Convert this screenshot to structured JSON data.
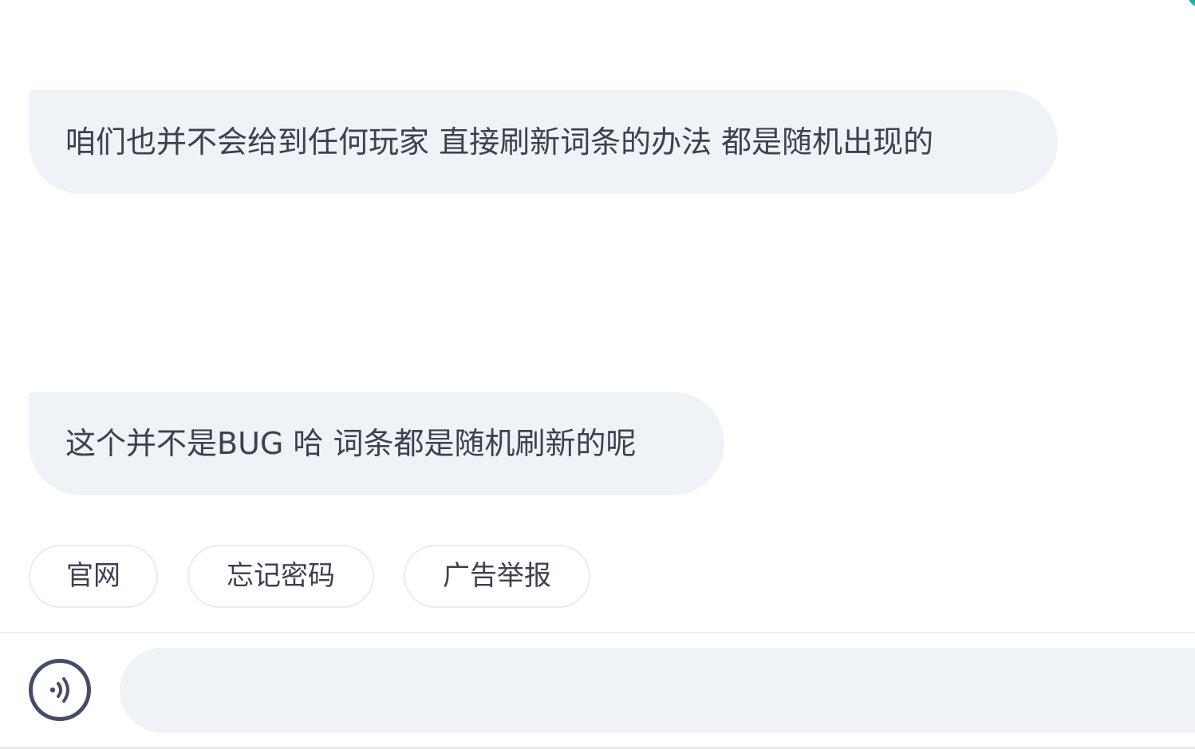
{
  "messages": [
    {
      "text": "咱们也并不会给到任何玩家 直接刷新词条的办法 都是随机出现的"
    },
    {
      "text": "这个并不是BUG 哈 词条都是随机刷新的呢"
    }
  ],
  "quick_replies": [
    {
      "label": "官网"
    },
    {
      "label": "忘记密码"
    },
    {
      "label": "广告举报"
    }
  ],
  "input": {
    "value": "",
    "placeholder": ""
  },
  "icons": {
    "voice": "voice-input-icon"
  },
  "colors": {
    "bubble_bg": "#eff3f7",
    "text": "#3c4150",
    "icon": "#454c66",
    "accent": "#1fb5a8"
  }
}
